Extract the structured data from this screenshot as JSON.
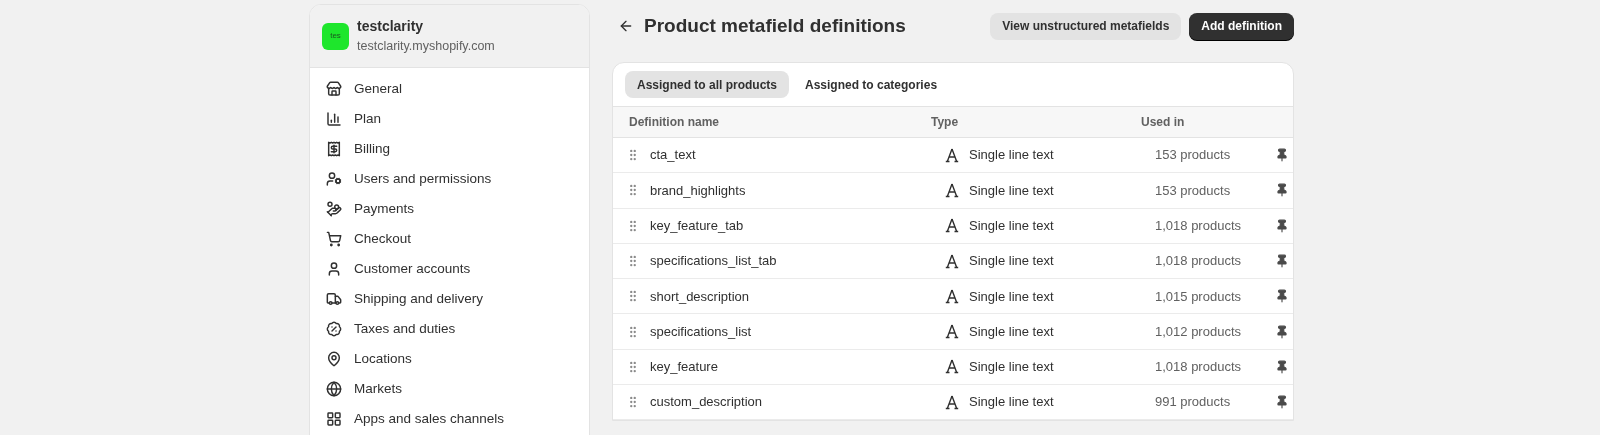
{
  "store": {
    "avatar": "tes",
    "name": "testclarity",
    "domain": "testclarity.myshopify.com"
  },
  "sidebar": {
    "items": [
      {
        "label": "General",
        "kind": "store"
      },
      {
        "label": "Plan",
        "kind": "plan"
      },
      {
        "label": "Billing",
        "kind": "billing"
      },
      {
        "label": "Users and permissions",
        "kind": "users"
      },
      {
        "label": "Payments",
        "kind": "payments"
      },
      {
        "label": "Checkout",
        "kind": "cart"
      },
      {
        "label": "Customer accounts",
        "kind": "person"
      },
      {
        "label": "Shipping and delivery",
        "kind": "truck"
      },
      {
        "label": "Taxes and duties",
        "kind": "tax"
      },
      {
        "label": "Locations",
        "kind": "location"
      },
      {
        "label": "Markets",
        "kind": "globe"
      },
      {
        "label": "Apps and sales channels",
        "kind": "apps"
      }
    ]
  },
  "page": {
    "title": "Product metafield definitions",
    "secondary_button": "View unstructured metafields",
    "primary_button": "Add definition"
  },
  "tabs": [
    {
      "label": "Assigned to all products",
      "selected": true
    },
    {
      "label": "Assigned to categories",
      "selected": false
    }
  ],
  "table": {
    "columns": [
      "Definition name",
      "Type",
      "Used in"
    ],
    "rows": [
      {
        "name": "cta_text",
        "type": "Single line text",
        "used_in": "153 products"
      },
      {
        "name": "brand_highlights",
        "type": "Single line text",
        "used_in": "153 products"
      },
      {
        "name": "key_feature_tab",
        "type": "Single line text",
        "used_in": "1,018 products"
      },
      {
        "name": "specifications_list_tab",
        "type": "Single line text",
        "used_in": "1,018 products"
      },
      {
        "name": "short_description",
        "type": "Single line text",
        "used_in": "1,015 products"
      },
      {
        "name": "specifications_list",
        "type": "Single line text",
        "used_in": "1,012 products"
      },
      {
        "name": "key_feature",
        "type": "Single line text",
        "used_in": "1,018 products"
      },
      {
        "name": "custom_description",
        "type": "Single line text",
        "used_in": "991 products"
      }
    ]
  }
}
